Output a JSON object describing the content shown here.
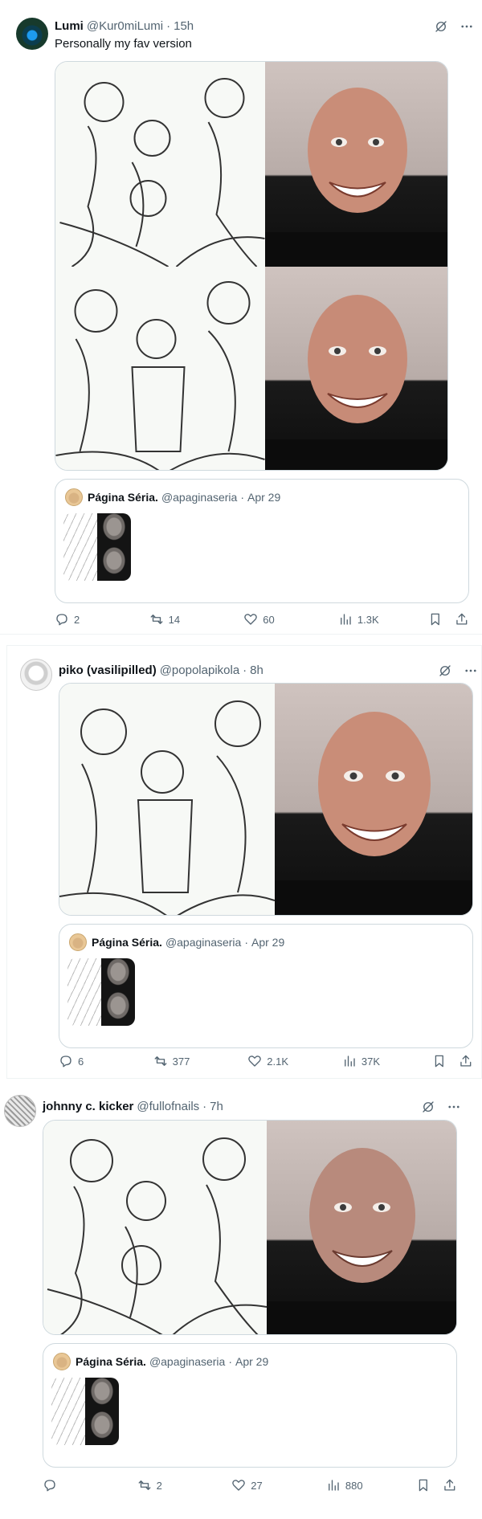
{
  "posts": [
    {
      "author_name": "Lumi",
      "handle": "@Kur0miLumi",
      "time": "15h",
      "text": "Personally my fav version",
      "quote": {
        "name": "Página Séria.",
        "handle": "@apaginaseria",
        "date": "Apr 29"
      },
      "stats": {
        "replies": "2",
        "reposts": "14",
        "likes": "60",
        "views": "1.3K"
      }
    },
    {
      "author_name": "piko (vasilipilled)",
      "handle": "@popolapikola",
      "time": "8h",
      "quote": {
        "name": "Página Séria.",
        "handle": "@apaginaseria",
        "date": "Apr 29"
      },
      "stats": {
        "replies": "6",
        "reposts": "377",
        "likes": "2.1K",
        "views": "37K"
      }
    },
    {
      "author_name": "johnny c. kicker",
      "handle": "@fullofnails",
      "time": "7h",
      "quote": {
        "name": "Página Séria.",
        "handle": "@apaginaseria",
        "date": "Apr 29"
      },
      "stats": {
        "replies": "",
        "reposts": "2",
        "likes": "27",
        "views": "880"
      }
    }
  ],
  "icons": {
    "avatar": "avatar-icon",
    "grok": "grok-icon",
    "more": "more-icon",
    "reply": "reply-icon",
    "repost": "repost-icon",
    "like": "like-icon",
    "views": "views-icon",
    "bookmark": "bookmark-icon",
    "share": "share-icon"
  },
  "colors": {
    "text": "#0f1419",
    "muted": "#536471",
    "border": "#cfd9de",
    "photo_bg": "#cfc3bf"
  }
}
